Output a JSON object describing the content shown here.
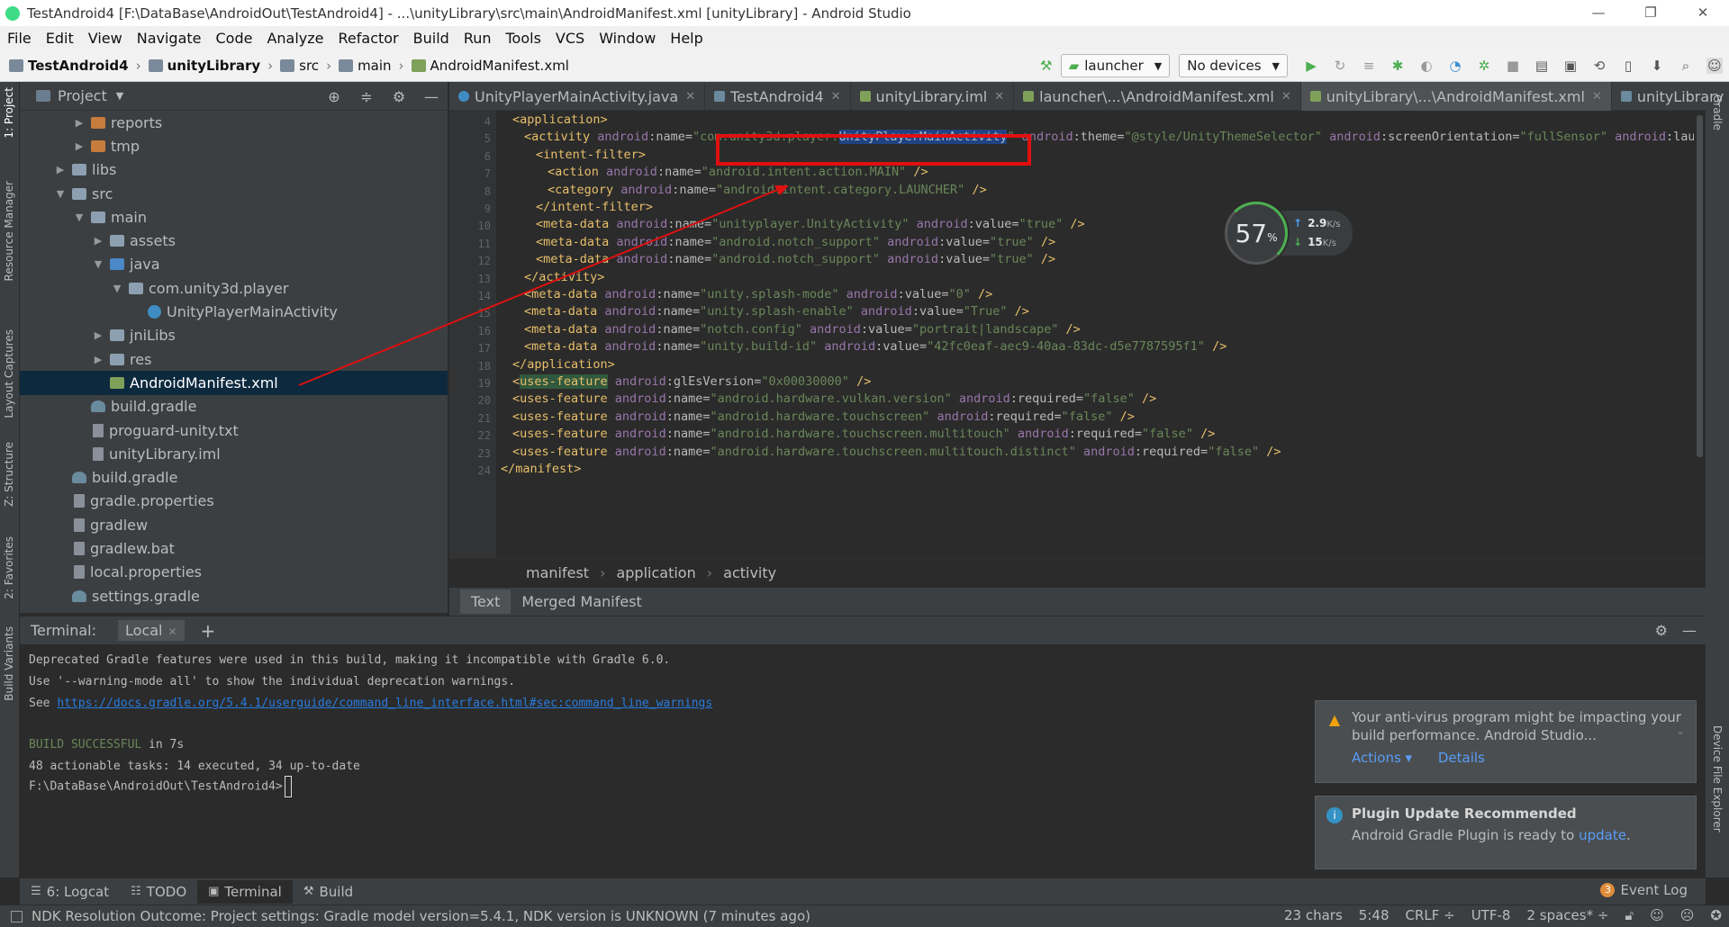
{
  "window": {
    "title": "TestAndroid4 [F:\\DataBase\\AndroidOut\\TestAndroid4] - ...\\unityLibrary\\src\\main\\AndroidManifest.xml [unityLibrary] - Android Studio",
    "controls": [
      "—",
      "❐",
      "✕"
    ]
  },
  "menu": [
    "File",
    "Edit",
    "View",
    "Navigate",
    "Code",
    "Analyze",
    "Refactor",
    "Build",
    "Run",
    "Tools",
    "VCS",
    "Window",
    "Help"
  ],
  "breadcrumb": [
    "TestAndroid4",
    "unityLibrary",
    "src",
    "main",
    "AndroidManifest.xml"
  ],
  "toolbar": {
    "run_config": "launcher",
    "device": "No devices"
  },
  "project_panel": {
    "title": "Project",
    "items": [
      {
        "label": "reports",
        "indent": 3,
        "arrow": "▶",
        "icon": "orange"
      },
      {
        "label": "tmp",
        "indent": 3,
        "arrow": "▶",
        "icon": "orange"
      },
      {
        "label": "libs",
        "indent": 2,
        "arrow": "▶",
        "icon": "gray"
      },
      {
        "label": "src",
        "indent": 2,
        "arrow": "▼",
        "icon": "gray"
      },
      {
        "label": "main",
        "indent": 3,
        "arrow": "▼",
        "icon": "gray"
      },
      {
        "label": "assets",
        "indent": 4,
        "arrow": "▶",
        "icon": "gray"
      },
      {
        "label": "java",
        "indent": 4,
        "arrow": "▼",
        "icon": "blue"
      },
      {
        "label": "com.unity3d.player",
        "indent": 5,
        "arrow": "▼",
        "icon": "gray"
      },
      {
        "label": "UnityPlayerMainActivity",
        "indent": 6,
        "arrow": "",
        "icon": "class"
      },
      {
        "label": "jniLibs",
        "indent": 4,
        "arrow": "▶",
        "icon": "gray"
      },
      {
        "label": "res",
        "indent": 4,
        "arrow": "▶",
        "icon": "gray"
      },
      {
        "label": "AndroidManifest.xml",
        "indent": 4,
        "arrow": "",
        "icon": "xml",
        "selected": true
      },
      {
        "label": "build.gradle",
        "indent": 3,
        "arrow": "",
        "icon": "gradle"
      },
      {
        "label": "proguard-unity.txt",
        "indent": 3,
        "arrow": "",
        "icon": "file"
      },
      {
        "label": "unityLibrary.iml",
        "indent": 3,
        "arrow": "",
        "icon": "file"
      },
      {
        "label": "build.gradle",
        "indent": 2,
        "arrow": "",
        "icon": "gradle"
      },
      {
        "label": "gradle.properties",
        "indent": 2,
        "arrow": "",
        "icon": "file"
      },
      {
        "label": "gradlew",
        "indent": 2,
        "arrow": "",
        "icon": "file"
      },
      {
        "label": "gradlew.bat",
        "indent": 2,
        "arrow": "",
        "icon": "file"
      },
      {
        "label": "local.properties",
        "indent": 2,
        "arrow": "",
        "icon": "file"
      },
      {
        "label": "settings.gradle",
        "indent": 2,
        "arrow": "",
        "icon": "gradle"
      }
    ]
  },
  "editor_tabs": [
    {
      "label": "UnityPlayerMainActivity.java",
      "icon": "class",
      "active": false
    },
    {
      "label": "TestAndroid4",
      "icon": "gradle",
      "active": false
    },
    {
      "label": "unityLibrary.iml",
      "icon": "file",
      "active": false
    },
    {
      "label": "launcher\\...\\AndroidManifest.xml",
      "icon": "xml",
      "active": false
    },
    {
      "label": "unityLibrary\\...\\AndroidManifest.xml",
      "icon": "xml",
      "active": true
    },
    {
      "label": "unityLibrary",
      "icon": "gradle",
      "active": false
    }
  ],
  "code": {
    "line_numbers": [
      "4",
      "5",
      "6",
      "7",
      "8",
      "9",
      "10",
      "11",
      "12",
      "13",
      "14",
      "15",
      "16",
      "17",
      "18",
      "19",
      "20",
      "21",
      "22",
      "23",
      "24"
    ],
    "lines": [
      [
        {
          "t": "<application>",
          "c": "tg"
        }
      ],
      [
        {
          "t": "<activity ",
          "c": "tg"
        },
        {
          "t": "android",
          "c": "ns"
        },
        {
          "t": ":name=",
          "c": "at"
        },
        {
          "t": "\"com.unity3d.player.",
          "c": "vl"
        },
        {
          "t": "UnityPlayerMainActivity",
          "c": "hl"
        },
        {
          "t": "\"",
          "c": "vl"
        },
        {
          "t": " android",
          "c": "ns"
        },
        {
          "t": ":theme=",
          "c": "at"
        },
        {
          "t": "\"@style/UnityThemeSelector\"",
          "c": "vl"
        },
        {
          "t": " android",
          "c": "ns"
        },
        {
          "t": ":screenOrientation=",
          "c": "at"
        },
        {
          "t": "\"fullSensor\"",
          "c": "vl"
        },
        {
          "t": " android",
          "c": "ns"
        },
        {
          "t": ":lau",
          "c": "at"
        }
      ],
      [
        {
          "t": "<intent-filter>",
          "c": "tg"
        }
      ],
      [
        {
          "t": "<action ",
          "c": "tg"
        },
        {
          "t": "android",
          "c": "ns"
        },
        {
          "t": ":name=",
          "c": "at"
        },
        {
          "t": "\"android.intent.action.MAIN\"",
          "c": "vl"
        },
        {
          "t": " />",
          "c": "tg"
        }
      ],
      [
        {
          "t": "<category ",
          "c": "tg"
        },
        {
          "t": "android",
          "c": "ns"
        },
        {
          "t": ":name=",
          "c": "at"
        },
        {
          "t": "\"android.intent.category.LAUNCHER\"",
          "c": "vl"
        },
        {
          "t": " />",
          "c": "tg"
        }
      ],
      [
        {
          "t": "</intent-filter>",
          "c": "tg"
        }
      ],
      [
        {
          "t": "<meta-data ",
          "c": "tg"
        },
        {
          "t": "android",
          "c": "ns"
        },
        {
          "t": ":name=",
          "c": "at"
        },
        {
          "t": "\"unityplayer.UnityActivity\"",
          "c": "vl"
        },
        {
          "t": " android",
          "c": "ns"
        },
        {
          "t": ":value=",
          "c": "at"
        },
        {
          "t": "\"true\"",
          "c": "vl"
        },
        {
          "t": " />",
          "c": "tg"
        }
      ],
      [
        {
          "t": "<meta-data ",
          "c": "tg"
        },
        {
          "t": "android",
          "c": "ns"
        },
        {
          "t": ":name=",
          "c": "at"
        },
        {
          "t": "\"android.notch_support\"",
          "c": "vl"
        },
        {
          "t": " android",
          "c": "ns"
        },
        {
          "t": ":value=",
          "c": "at"
        },
        {
          "t": "\"true\"",
          "c": "vl"
        },
        {
          "t": " />",
          "c": "tg"
        }
      ],
      [
        {
          "t": "<meta-data ",
          "c": "tg"
        },
        {
          "t": "android",
          "c": "ns"
        },
        {
          "t": ":name=",
          "c": "at"
        },
        {
          "t": "\"android.notch_support\"",
          "c": "vl"
        },
        {
          "t": " android",
          "c": "ns"
        },
        {
          "t": ":value=",
          "c": "at"
        },
        {
          "t": "\"true\"",
          "c": "vl"
        },
        {
          "t": " />",
          "c": "tg"
        }
      ],
      [
        {
          "t": "</activity>",
          "c": "tg"
        }
      ],
      [
        {
          "t": "<meta-data ",
          "c": "tg"
        },
        {
          "t": "android",
          "c": "ns"
        },
        {
          "t": ":name=",
          "c": "at"
        },
        {
          "t": "\"unity.splash-mode\"",
          "c": "vl"
        },
        {
          "t": " android",
          "c": "ns"
        },
        {
          "t": ":value=",
          "c": "at"
        },
        {
          "t": "\"0\"",
          "c": "vl"
        },
        {
          "t": " />",
          "c": "tg"
        }
      ],
      [
        {
          "t": "<meta-data ",
          "c": "tg"
        },
        {
          "t": "android",
          "c": "ns"
        },
        {
          "t": ":name=",
          "c": "at"
        },
        {
          "t": "\"unity.splash-enable\"",
          "c": "vl"
        },
        {
          "t": " android",
          "c": "ns"
        },
        {
          "t": ":value=",
          "c": "at"
        },
        {
          "t": "\"True\"",
          "c": "vl"
        },
        {
          "t": " />",
          "c": "tg"
        }
      ],
      [
        {
          "t": "<meta-data ",
          "c": "tg"
        },
        {
          "t": "android",
          "c": "ns"
        },
        {
          "t": ":name=",
          "c": "at"
        },
        {
          "t": "\"notch.config\"",
          "c": "vl"
        },
        {
          "t": " android",
          "c": "ns"
        },
        {
          "t": ":value=",
          "c": "at"
        },
        {
          "t": "\"portrait|landscape\"",
          "c": "vl"
        },
        {
          "t": " />",
          "c": "tg"
        }
      ],
      [
        {
          "t": "<meta-data ",
          "c": "tg"
        },
        {
          "t": "android",
          "c": "ns"
        },
        {
          "t": ":name=",
          "c": "at"
        },
        {
          "t": "\"unity.build-id\"",
          "c": "vl"
        },
        {
          "t": " android",
          "c": "ns"
        },
        {
          "t": ":value=",
          "c": "at"
        },
        {
          "t": "\"42fc0eaf-aec9-40aa-83dc-d5e7787595f1\"",
          "c": "vl"
        },
        {
          "t": " />",
          "c": "tg"
        }
      ],
      [
        {
          "t": "</application>",
          "c": "tg"
        }
      ],
      [
        {
          "t": "<",
          "c": "tg"
        },
        {
          "t": "uses-feature",
          "c": "uf"
        },
        {
          "t": " android",
          "c": "ns"
        },
        {
          "t": ":glEsVersion=",
          "c": "at"
        },
        {
          "t": "\"0x00030000\"",
          "c": "vl"
        },
        {
          "t": " />",
          "c": "tg"
        }
      ],
      [
        {
          "t": "<uses-feature ",
          "c": "tg"
        },
        {
          "t": "android",
          "c": "ns"
        },
        {
          "t": ":name=",
          "c": "at"
        },
        {
          "t": "\"android.hardware.vulkan.version\"",
          "c": "vl"
        },
        {
          "t": " android",
          "c": "ns"
        },
        {
          "t": ":required=",
          "c": "at"
        },
        {
          "t": "\"false\"",
          "c": "vl"
        },
        {
          "t": " />",
          "c": "tg"
        }
      ],
      [
        {
          "t": "<uses-feature ",
          "c": "tg"
        },
        {
          "t": "android",
          "c": "ns"
        },
        {
          "t": ":name=",
          "c": "at"
        },
        {
          "t": "\"android.hardware.touchscreen\"",
          "c": "vl"
        },
        {
          "t": " android",
          "c": "ns"
        },
        {
          "t": ":required=",
          "c": "at"
        },
        {
          "t": "\"false\"",
          "c": "vl"
        },
        {
          "t": " />",
          "c": "tg"
        }
      ],
      [
        {
          "t": "<uses-feature ",
          "c": "tg"
        },
        {
          "t": "android",
          "c": "ns"
        },
        {
          "t": ":name=",
          "c": "at"
        },
        {
          "t": "\"android.hardware.touchscreen.multitouch\"",
          "c": "vl"
        },
        {
          "t": " android",
          "c": "ns"
        },
        {
          "t": ":required=",
          "c": "at"
        },
        {
          "t": "\"false\"",
          "c": "vl"
        },
        {
          "t": " />",
          "c": "tg"
        }
      ],
      [
        {
          "t": "<uses-feature ",
          "c": "tg"
        },
        {
          "t": "android",
          "c": "ns"
        },
        {
          "t": ":name=",
          "c": "at"
        },
        {
          "t": "\"android.hardware.touchscreen.multitouch.distinct\"",
          "c": "vl"
        },
        {
          "t": " android",
          "c": "ns"
        },
        {
          "t": ":required=",
          "c": "at"
        },
        {
          "t": "\"false\"",
          "c": "vl"
        },
        {
          "t": " />",
          "c": "tg"
        }
      ],
      [
        {
          "t": "</manifest>",
          "c": "tg"
        }
      ]
    ],
    "indents": [
      6,
      7,
      8,
      9,
      9,
      8,
      8,
      8,
      8,
      7,
      7,
      7,
      7,
      7,
      6,
      6,
      6,
      6,
      6,
      6,
      5
    ]
  },
  "editor_breadcrumb": [
    "manifest",
    "application",
    "activity"
  ],
  "manifest_tabs": [
    "Text",
    "Merged Manifest"
  ],
  "speed_widget": {
    "percent": "57",
    "unit": "%",
    "upload": "2.9",
    "download": "15",
    "rate_unit": "K/s"
  },
  "terminal": {
    "label": "Terminal:",
    "session": "Local",
    "lines": [
      "Deprecated Gradle features were used in this build, making it incompatible with Gradle 6.0.",
      "Use '--warning-mode all' to show the individual deprecation warnings.",
      "See "
    ],
    "link": "https://docs.gradle.org/5.4.1/userguide/command_line_interface.html#sec:command_line_warnings",
    "build_status": "BUILD SUCCESSFUL",
    "build_time": " in 7s",
    "tasks_line": "48 actionable tasks: 14 executed, 34 up-to-date",
    "prompt": "F:\\DataBase\\AndroidOut\\TestAndroid4>"
  },
  "notifications": [
    {
      "text": "Your anti-virus program might be impacting your build performance. Android Studio...",
      "actions": [
        "Actions ▾",
        "Details"
      ]
    },
    {
      "title": "Plugin Update Recommended",
      "text_prefix": "Android Gradle Plugin is ready to ",
      "link": "update",
      "text_suffix": "."
    }
  ],
  "bottom_tools": [
    "6: Logcat",
    "TODO",
    "Terminal",
    "Build"
  ],
  "event_log": {
    "label": "Event Log",
    "count": "3"
  },
  "left_strip": [
    "1: Project",
    "Resource Manager",
    "Layout Captures",
    "Z: Structure",
    "2: Favorites",
    "Build Variants"
  ],
  "right_strip": [
    "Gradle",
    "Device File Explorer"
  ],
  "status": {
    "message": "NDK Resolution Outcome: Project settings: Gradle model version=5.4.1, NDK version is UNKNOWN (7 minutes ago)",
    "chars": "23 chars",
    "position": "5:48",
    "line_sep": "CRLF ÷",
    "encoding": "UTF-8",
    "indent": "2 spaces* ÷"
  },
  "colors": {
    "accent_red": "#e01010",
    "selection": "#0d293e",
    "link": "#589df6"
  }
}
